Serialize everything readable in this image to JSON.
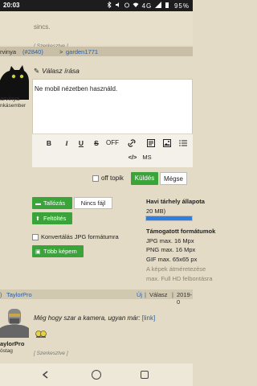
{
  "status_bar": {
    "time": "20:03",
    "battery": "95%",
    "network": "4G"
  },
  "previous_post": {
    "text": "sincs.",
    "edited": "[ Szerkesztve ]"
  },
  "post_header": {
    "user": "rvinya",
    "post_number": "(#2840)",
    "arrow": ">",
    "reply_target": "garden1771"
  },
  "author": {
    "name": "arvinya",
    "rank": "nkásember"
  },
  "reply": {
    "title": "Válasz írása",
    "content": "Ne mobil nézetben használd.",
    "toolbar": {
      "bold": "B",
      "italic": "I",
      "underline": "U",
      "strike": "S",
      "off": "OFF",
      "source": "</>",
      "ms": "MS"
    },
    "offtopic_label": "off topik",
    "send_label": "Küldés",
    "cancel_label": "Mégse"
  },
  "upload": {
    "browse_label": "Tallózás",
    "no_file_label": "Nincs fájl",
    "upload_label": "Feltöltés",
    "convert_label": "Konvertálás JPG formátumra",
    "more_images_label": "Több képem"
  },
  "quota": {
    "title": "Havi tárhely állapota",
    "size": "20 MB)",
    "usage_fraction": 1.0,
    "formats_title": "Támogatott formátumok",
    "formats": [
      "JPG max. 16 Mpx",
      "PNG max. 16 Mpx",
      "GIF max. 65x65 px",
      "A képek átméretezése",
      "max. Full HD felbontásra"
    ]
  },
  "next_post_header": {
    "arrow": ")",
    "user": "TaylorPro",
    "new_label": "Új",
    "reply_label": "Válasz",
    "date": "2019-0"
  },
  "next_post": {
    "author_name": "aylorPro",
    "author_rank": "östag",
    "text": "Még hogy szar a kamera, ugyan már:",
    "link_label": "[link]",
    "edited": "[ Szerkesztve ]"
  },
  "colors": {
    "background": "#e3dbc5",
    "accent_green": "#3aa43a",
    "link_blue": "#2a5fa8",
    "quota_blue": "#2f7fe0"
  }
}
